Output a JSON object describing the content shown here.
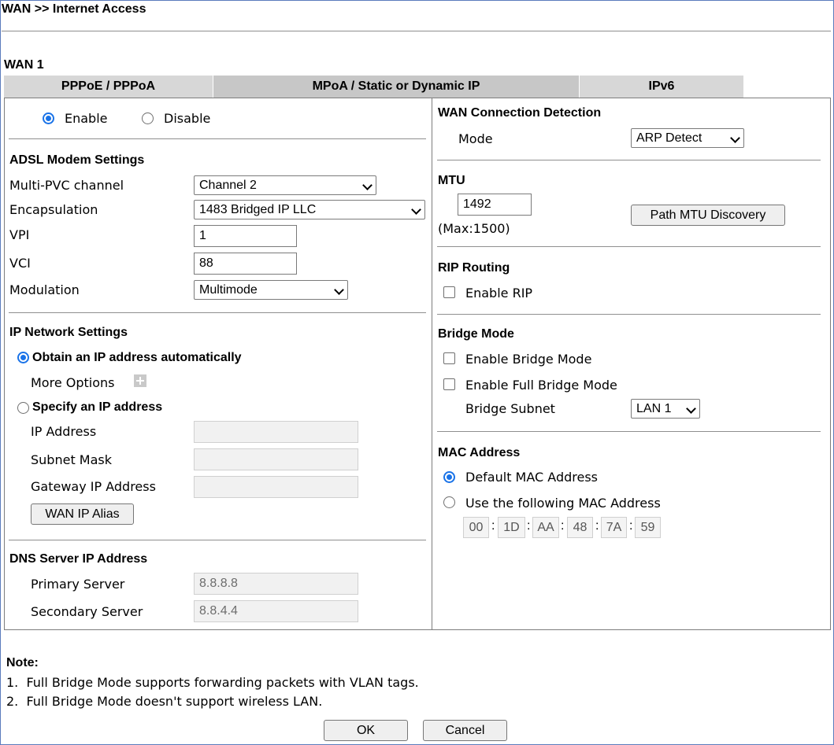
{
  "header": {
    "title": "WAN >> Internet Access",
    "wan_label": "WAN 1"
  },
  "tabs": [
    {
      "label": "PPPoE / PPPoA",
      "active": false
    },
    {
      "label": "MPoA / Static or Dynamic IP",
      "active": true
    },
    {
      "label": "IPv6",
      "active": false
    }
  ],
  "status": {
    "enable_label": "Enable",
    "disable_label": "Disable",
    "selected": "Enable"
  },
  "adsl": {
    "title": "ADSL Modem Settings",
    "multi_pvc_label": "Multi-PVC channel",
    "multi_pvc_value": "Channel 2",
    "encapsulation_label": "Encapsulation",
    "encapsulation_value": "1483 Bridged IP LLC",
    "vpi_label": "VPI",
    "vpi_value": "1",
    "vci_label": "VCI",
    "vci_value": "88",
    "modulation_label": "Modulation",
    "modulation_value": "Multimode"
  },
  "ip_network": {
    "title": "IP Network Settings",
    "obtain_auto_label": "Obtain an IP address automatically",
    "more_options_label": "More Options",
    "specify_label": "Specify an IP address",
    "ip_address_label": "IP Address",
    "ip_address_value": "",
    "subnet_mask_label": "Subnet Mask",
    "subnet_mask_value": "",
    "gateway_label": "Gateway IP Address",
    "gateway_value": "",
    "wan_ip_alias_label": "WAN IP Alias"
  },
  "dns": {
    "title": "DNS Server IP Address",
    "primary_label": "Primary Server",
    "primary_value": "8.8.8.8",
    "secondary_label": "Secondary Server",
    "secondary_value": "8.8.4.4"
  },
  "detection": {
    "title": "WAN Connection Detection",
    "mode_label": "Mode",
    "mode_value": "ARP Detect"
  },
  "mtu": {
    "title": "MTU",
    "value": "1492",
    "max_label": "(Max:1500)",
    "discovery_label": "Path MTU Discovery"
  },
  "rip": {
    "title": "RIP Routing",
    "enable_label": "Enable RIP"
  },
  "bridge": {
    "title": "Bridge Mode",
    "enable_label": "Enable Bridge Mode",
    "full_label": "Enable Full Bridge Mode",
    "subnet_label": "Bridge Subnet",
    "subnet_value": "LAN 1"
  },
  "mac": {
    "title": "MAC Address",
    "default_label": "Default MAC Address",
    "custom_label": "Use the following MAC Address",
    "octets": [
      "00",
      "1D",
      "AA",
      "48",
      "7A",
      "59"
    ],
    "separator": ":"
  },
  "notes": {
    "title": "Note:",
    "items": [
      "1.  Full Bridge Mode supports forwarding packets with VLAN tags.",
      "2.  Full Bridge Mode doesn't support wireless LAN."
    ]
  },
  "actions": {
    "ok_label": "OK",
    "cancel_label": "Cancel"
  }
}
